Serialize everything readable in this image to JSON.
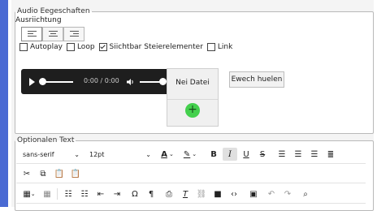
{
  "audio": {
    "legend": "Audio Eegeschaften",
    "align_label": "Ausriichtung",
    "align_buttons": [
      {
        "icon": "align-left-icon"
      },
      {
        "icon": "align-center-icon"
      },
      {
        "icon": "align-right-icon"
      }
    ],
    "options": [
      {
        "label": "Autoplay",
        "checked": false
      },
      {
        "label": "Loop",
        "checked": false
      },
      {
        "label": "Siichtbar Steierelementer",
        "checked": true
      },
      {
        "label": "Link",
        "checked": false
      }
    ],
    "player": {
      "time": "0:00 / 0:00",
      "progress": 0,
      "volume": 1
    },
    "upload": {
      "label": "Nei Datei",
      "add_icon": "plus-icon"
    },
    "choose_button": "Ewech huelen"
  },
  "text": {
    "legend": "Optionalen Text",
    "font_family": "sans-serif",
    "font_size": "12pt",
    "toolbar_row1_icons": [
      "font-color-icon",
      "highlight-icon",
      "bold-icon",
      "italic-icon",
      "underline-icon",
      "strikethrough-icon",
      "align-left-icon",
      "align-center-icon",
      "align-right-icon",
      "align-justify-icon"
    ],
    "toolbar_row2_icons": [
      "cut-icon",
      "copy-icon",
      "paste-icon",
      "paste-text-icon"
    ],
    "toolbar_row3_icons": [
      "table-icon",
      "table-props-icon",
      "bullet-list-icon",
      "numbered-list-icon",
      "outdent-icon",
      "indent-icon",
      "omega-icon",
      "pilcrow-icon",
      "print-icon",
      "clear-format-icon",
      "unlink-icon",
      "bookmark-icon",
      "code-icon",
      "image-icon",
      "undo-icon",
      "redo-icon",
      "search-icon"
    ]
  },
  "colors": {
    "accent": "#4a6ad3",
    "add_button": "#44d04d",
    "player_bg": "#1e1e1e"
  }
}
